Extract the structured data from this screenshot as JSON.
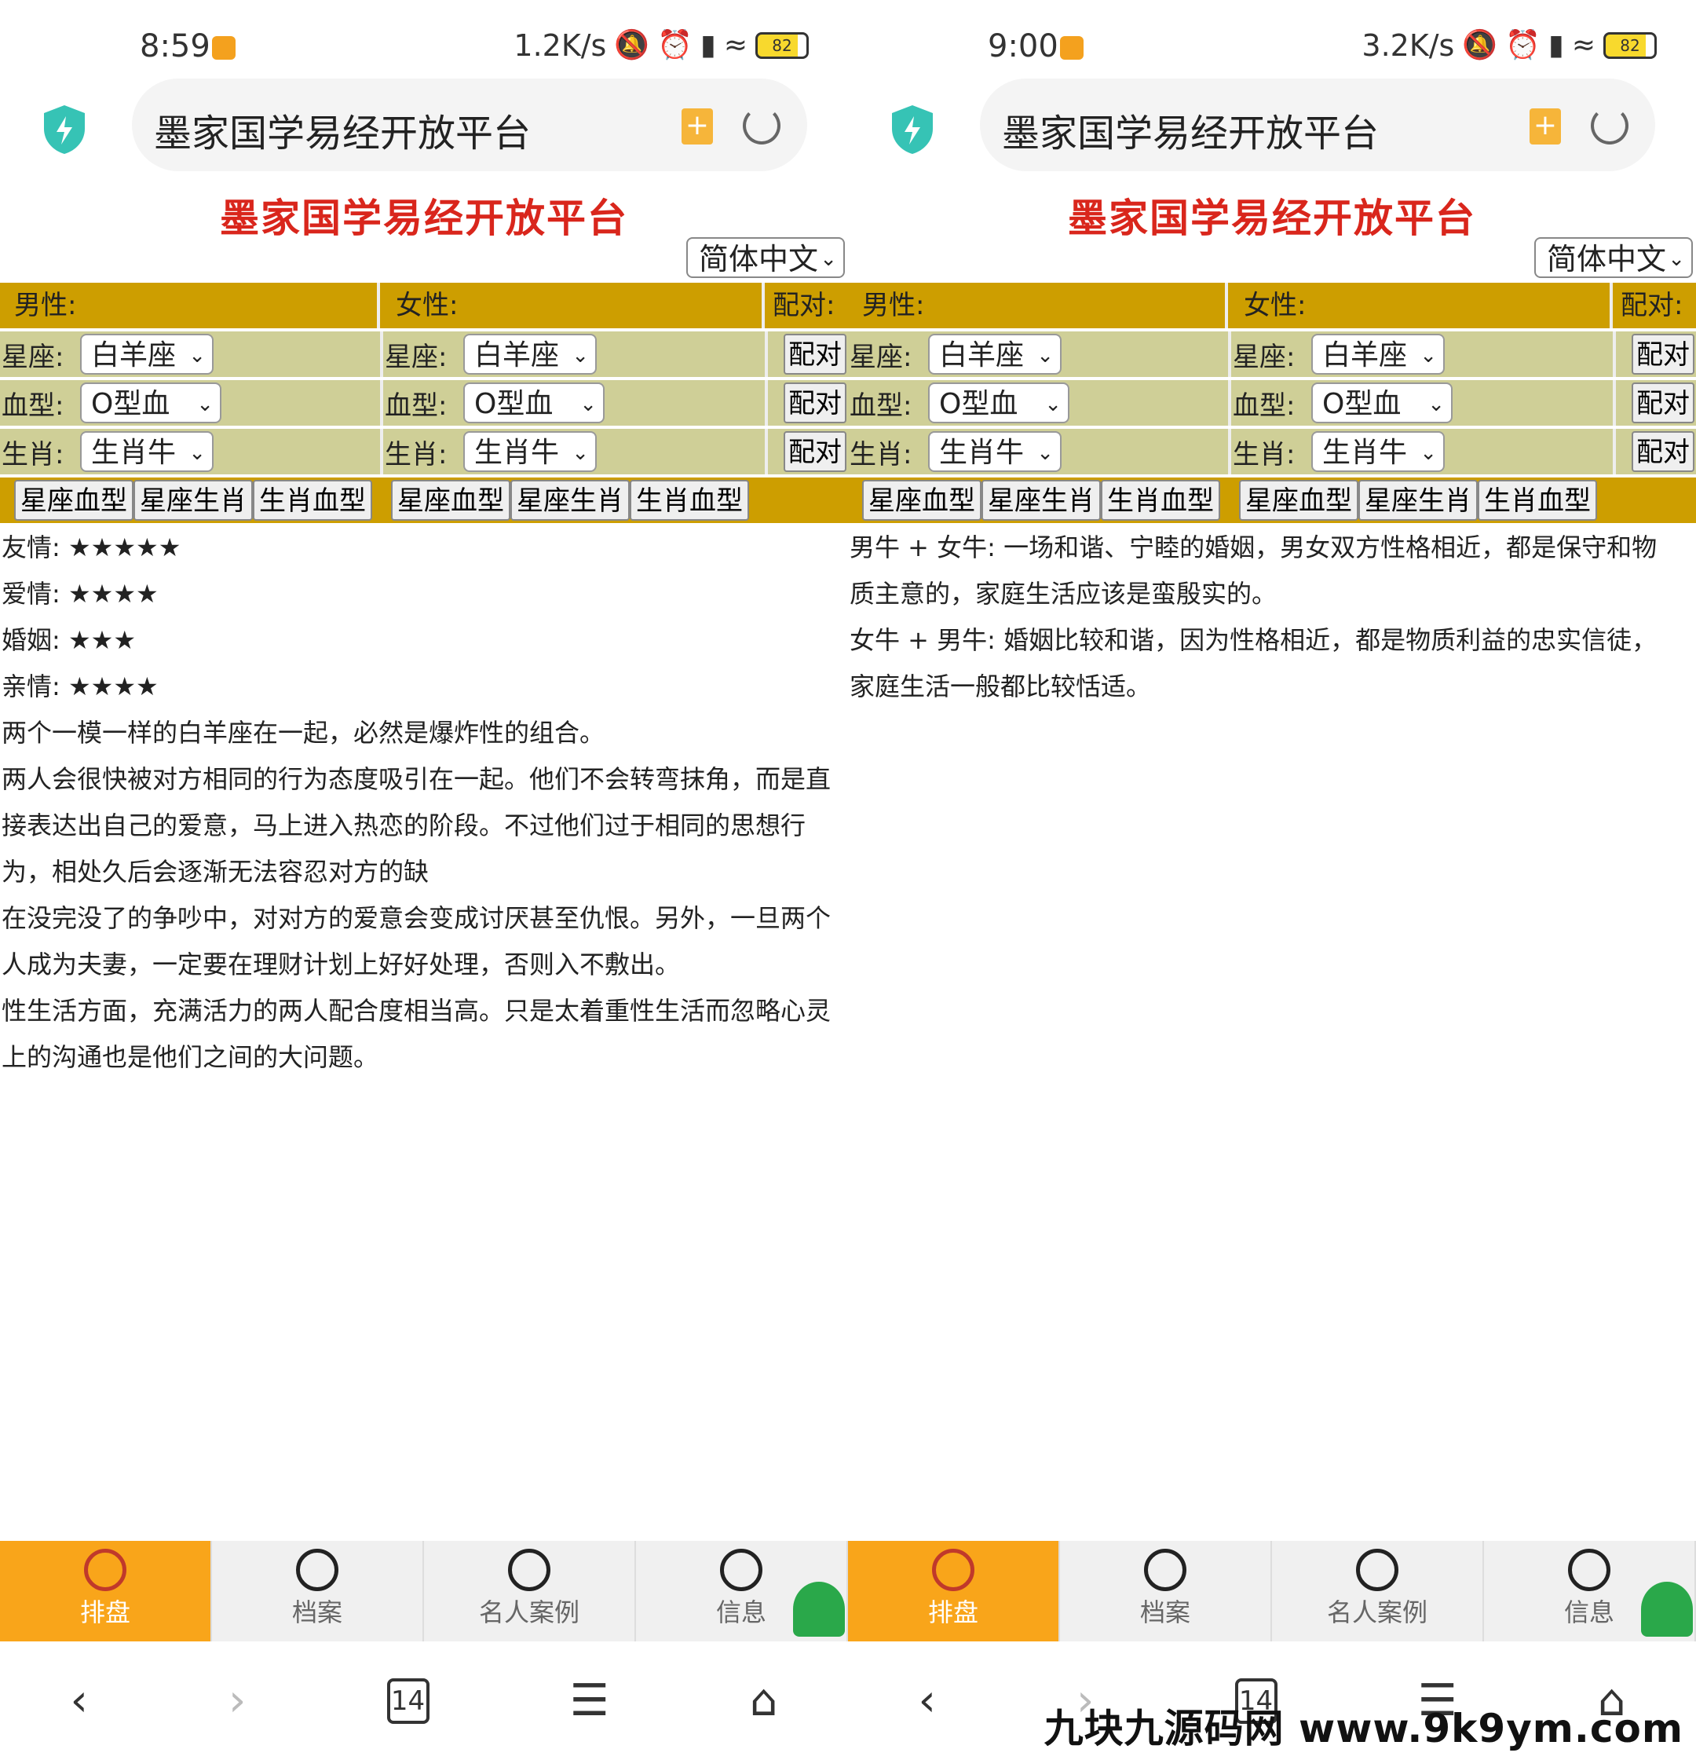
{
  "brand_colors": {
    "title_red": "#d9261c",
    "header_gold": "#cd9e00",
    "row_khaki": "#cfcf97",
    "tab_active": "#f9a51a"
  },
  "panels": [
    {
      "status": {
        "time": "8:59",
        "speed": "1.2K/s",
        "battery": "82"
      },
      "browser": {
        "url_text": "墨家国学易经开放平台"
      },
      "page": {
        "title": "墨家国学易经开放平台",
        "lang": "简体中文",
        "headers": {
          "male": "男性:",
          "female": "女性:",
          "match": "配对:"
        },
        "rows": [
          {
            "label": "星座:",
            "male_value": "白羊座",
            "female_value": "白羊座",
            "button": "配对"
          },
          {
            "label": "血型:",
            "male_value": "O型血",
            "female_value": "O型血",
            "button": "配对"
          },
          {
            "label": "生肖:",
            "male_value": "生肖牛",
            "female_value": "生肖牛",
            "button": "配对"
          }
        ],
        "combo_buttons": [
          "星座血型",
          "星座生肖",
          "生肖血型"
        ],
        "result_lines": [
          "友情: ★★★★★",
          "爱情: ★★★★",
          "婚姻: ★★★",
          "亲情: ★★★★",
          "两个一模一样的白羊座在一起，必然是爆炸性的组合。",
          "两人会很快被对方相同的行为态度吸引在一起。他们不会转弯抹角，而是直接表达出自己的爱意，马上进入热恋的阶段。不过他们过于相同的思想行为，相处久后会逐渐无法容忍对方的缺",
          "在没完没了的争吵中，对对方的爱意会变成讨厌甚至仇恨。另外，一旦两个人成为夫妻，一定要在理财计划上好好处理，否则入不敷出。",
          "性生活方面，充满活力的两人配合度相当高。只是太着重性生活而忽略心灵上的沟通也是他们之间的大问题。"
        ]
      },
      "tabs": [
        {
          "label": "排盘",
          "icon": "bagua-icon"
        },
        {
          "label": "档案",
          "icon": "clock-icon"
        },
        {
          "label": "名人案例",
          "icon": "yinyang-icon"
        },
        {
          "label": "信息",
          "icon": "user-icon"
        }
      ],
      "sysnav": {
        "tab_count": "14"
      }
    },
    {
      "status": {
        "time": "9:00",
        "speed": "3.2K/s",
        "battery": "82"
      },
      "browser": {
        "url_text": "墨家国学易经开放平台"
      },
      "page": {
        "title": "墨家国学易经开放平台",
        "lang": "简体中文",
        "headers": {
          "male": "男性:",
          "female": "女性:",
          "match": "配对:"
        },
        "rows": [
          {
            "label": "星座:",
            "male_value": "白羊座",
            "female_value": "白羊座",
            "button": "配对"
          },
          {
            "label": "血型:",
            "male_value": "O型血",
            "female_value": "O型血",
            "button": "配对"
          },
          {
            "label": "生肖:",
            "male_value": "生肖牛",
            "female_value": "生肖牛",
            "button": "配对"
          }
        ],
        "combo_buttons": [
          "星座血型",
          "星座生肖",
          "生肖血型"
        ],
        "result_lines": [
          "男牛 + 女牛: 一场和谐、宁睦的婚姻，男女双方性格相近，都是保守和物质主意的，家庭生活应该是蛮殷实的。",
          "女牛 + 男牛: 婚姻比较和谐，因为性格相近，都是物质利益的忠实信徒，家庭生活一般都比较恬适。"
        ]
      },
      "tabs": [
        {
          "label": "排盘",
          "icon": "bagua-icon"
        },
        {
          "label": "档案",
          "icon": "clock-icon"
        },
        {
          "label": "名人案例",
          "icon": "yinyang-icon"
        },
        {
          "label": "信息",
          "icon": "user-icon"
        }
      ],
      "sysnav": {
        "tab_count": "14"
      }
    }
  ],
  "watermark": "九块九源码网 www.9k9ym.com"
}
